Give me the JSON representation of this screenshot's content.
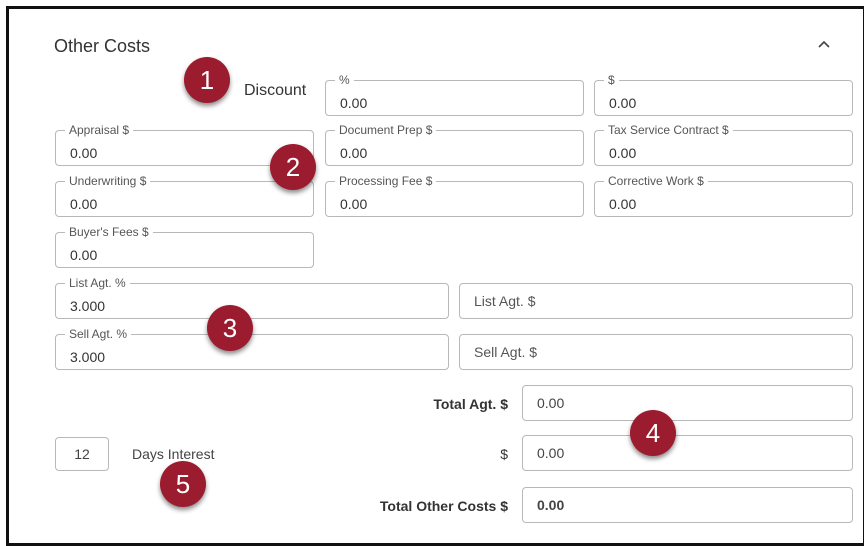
{
  "section": {
    "title": "Other Costs"
  },
  "discount": {
    "label": "Discount",
    "percent": {
      "label": "%",
      "value": "0.00"
    },
    "dollar": {
      "label": "$",
      "value": "0.00"
    }
  },
  "fees": {
    "appraisal": {
      "label": "Appraisal $",
      "value": "0.00"
    },
    "document_prep": {
      "label": "Document Prep $",
      "value": "0.00"
    },
    "tax_service": {
      "label": "Tax Service Contract $",
      "value": "0.00"
    },
    "underwriting": {
      "label": "Underwriting $",
      "value": "0.00"
    },
    "processing_fee": {
      "label": "Processing Fee $",
      "value": "0.00"
    },
    "corrective_work": {
      "label": "Corrective Work $",
      "value": "0.00"
    },
    "buyers_fees": {
      "label": "Buyer's Fees $",
      "value": "0.00"
    }
  },
  "agents": {
    "list_pct": {
      "label": "List Agt. %",
      "value": "3.000"
    },
    "list_dollar": {
      "placeholder": "List Agt. $"
    },
    "sell_pct": {
      "label": "Sell Agt. %",
      "value": "3.000"
    },
    "sell_dollar": {
      "placeholder": "Sell Agt. $"
    }
  },
  "totals": {
    "total_agt": {
      "label": "Total Agt. $",
      "value": "0.00"
    },
    "interest": {
      "label": "$",
      "value": "0.00"
    },
    "total_other": {
      "label": "Total Other Costs $",
      "value": "0.00"
    }
  },
  "days_interest": {
    "value": "12",
    "label": "Days Interest"
  },
  "badges": [
    "1",
    "2",
    "3",
    "4",
    "5"
  ],
  "colors": {
    "badge": "#9b1c2e",
    "border": "#b8b8b8"
  }
}
